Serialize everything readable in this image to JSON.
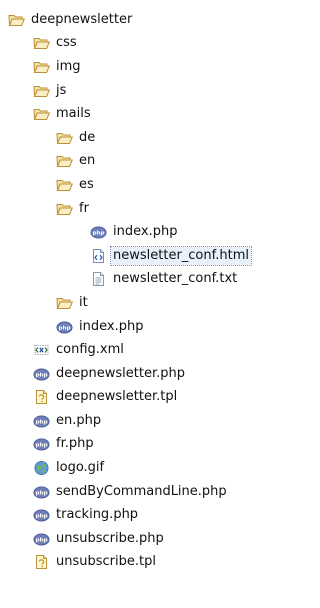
{
  "tree": [
    {
      "label": "deepnewsletter",
      "icon": "folder-open-icon",
      "depth": 0
    },
    {
      "label": "css",
      "icon": "folder-open-icon",
      "depth": 1
    },
    {
      "label": "img",
      "icon": "folder-open-icon",
      "depth": 1
    },
    {
      "label": "js",
      "icon": "folder-open-icon",
      "depth": 1
    },
    {
      "label": "mails",
      "icon": "folder-open-icon",
      "depth": 1
    },
    {
      "label": "de",
      "icon": "folder-open-icon",
      "depth": 2
    },
    {
      "label": "en",
      "icon": "folder-open-icon",
      "depth": 2
    },
    {
      "label": "es",
      "icon": "folder-open-icon",
      "depth": 2
    },
    {
      "label": "fr",
      "icon": "folder-open-icon",
      "depth": 2
    },
    {
      "label": "index.php",
      "icon": "php-file-icon",
      "depth": 3
    },
    {
      "label": "newsletter_conf.html",
      "icon": "html-file-icon",
      "depth": 3,
      "selected": true
    },
    {
      "label": "newsletter_conf.txt",
      "icon": "text-file-icon",
      "depth": 3
    },
    {
      "label": "it",
      "icon": "folder-open-icon",
      "depth": 2
    },
    {
      "label": "index.php",
      "icon": "php-file-icon",
      "depth": 2
    },
    {
      "label": "config.xml",
      "icon": "xml-file-icon",
      "depth": 1
    },
    {
      "label": "deepnewsletter.php",
      "icon": "php-file-icon",
      "depth": 1
    },
    {
      "label": "deepnewsletter.tpl",
      "icon": "template-file-icon",
      "depth": 1
    },
    {
      "label": "en.php",
      "icon": "php-file-icon",
      "depth": 1
    },
    {
      "label": "fr.php",
      "icon": "php-file-icon",
      "depth": 1
    },
    {
      "label": "logo.gif",
      "icon": "image-file-icon",
      "depth": 1
    },
    {
      "label": "sendByCommandLine.php",
      "icon": "php-file-icon",
      "depth": 1
    },
    {
      "label": "tracking.php",
      "icon": "php-file-icon",
      "depth": 1
    },
    {
      "label": "unsubscribe.php",
      "icon": "php-file-icon",
      "depth": 1
    },
    {
      "label": "unsubscribe.tpl",
      "icon": "template-file-icon",
      "depth": 1
    }
  ]
}
